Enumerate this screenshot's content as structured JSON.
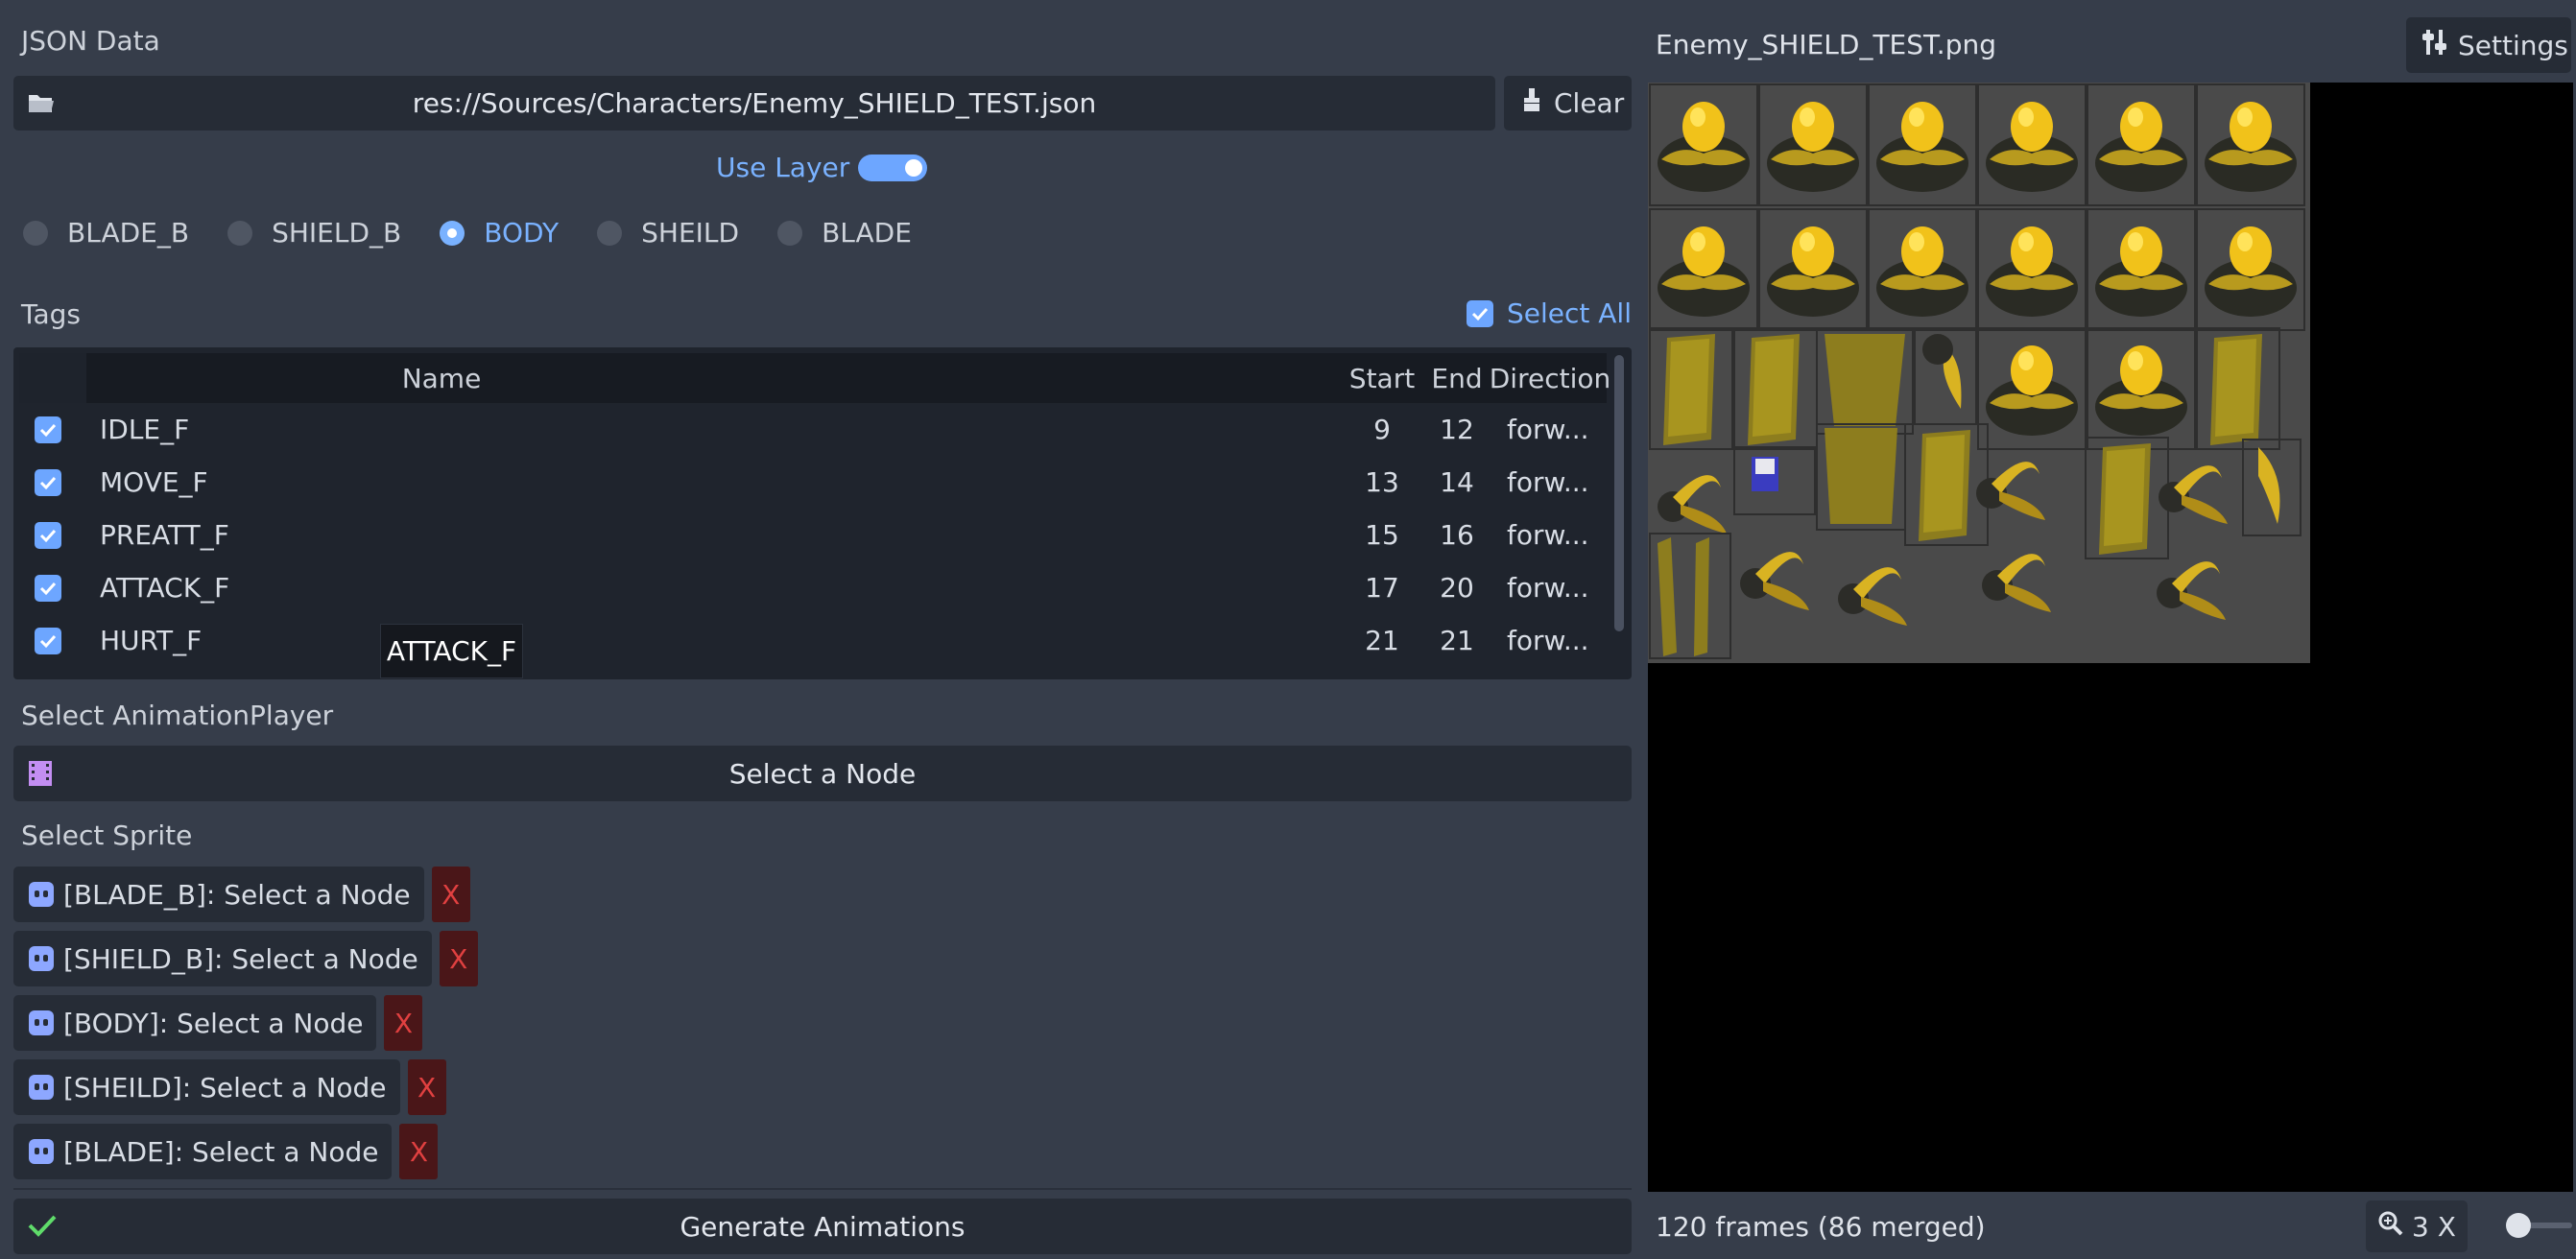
{
  "json_section": {
    "title": "JSON Data",
    "file_path": "res://Sources/Characters/Enemy_SHIELD_TEST.json",
    "clear_label": "Clear",
    "use_layer_label": "Use Layer",
    "use_layer_on": true,
    "layers": [
      {
        "label": "BLADE_B",
        "selected": false
      },
      {
        "label": "SHIELD_B",
        "selected": false
      },
      {
        "label": "BODY",
        "selected": true
      },
      {
        "label": "SHEILD",
        "selected": false
      },
      {
        "label": "BLADE",
        "selected": false
      }
    ]
  },
  "tags": {
    "title": "Tags",
    "select_all_label": "Select All",
    "select_all_checked": true,
    "columns": [
      "Name",
      "Start",
      "End",
      "Direction"
    ],
    "rows": [
      {
        "name": "IDLE_F",
        "start": "9",
        "end": "12",
        "direction": "forw...",
        "checked": true
      },
      {
        "name": "MOVE_F",
        "start": "13",
        "end": "14",
        "direction": "forw...",
        "checked": true
      },
      {
        "name": "PREATT_F",
        "start": "15",
        "end": "16",
        "direction": "forw...",
        "checked": true
      },
      {
        "name": "ATTACK_F",
        "start": "17",
        "end": "20",
        "direction": "forw...",
        "checked": true
      },
      {
        "name": "HURT_F",
        "start": "21",
        "end": "21",
        "direction": "forw...",
        "checked": true
      }
    ],
    "tooltip": "ATTACK_F"
  },
  "animation_player": {
    "title": "Select AnimationPlayer",
    "button_label": "Select a Node"
  },
  "sprites": {
    "title": "Select Sprite",
    "items": [
      {
        "label": "[BLADE_B]: Select a Node",
        "remove": "X"
      },
      {
        "label": "[SHIELD_B]: Select a Node",
        "remove": "X"
      },
      {
        "label": "[BODY]: Select a Node",
        "remove": "X"
      },
      {
        "label": "[SHEILD]: Select a Node",
        "remove": "X"
      },
      {
        "label": "[BLADE]: Select a Node",
        "remove": "X"
      }
    ]
  },
  "generate_label": "Generate Animations",
  "preview": {
    "filename": "Enemy_SHIELD_TEST.png",
    "settings_label": "Settings",
    "frames_info": "120 frames (86 merged)",
    "zoom_label": "3 X",
    "zoom_level": 0.3
  },
  "colors": {
    "accent": "#7ab2ff",
    "background": "#363d4a",
    "panel": "#262c36",
    "danger": "#e04040",
    "confirm": "#5fdc6a"
  }
}
